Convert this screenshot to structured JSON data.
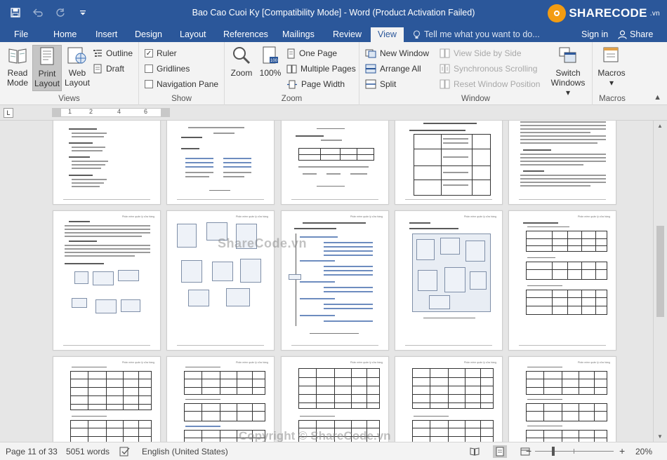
{
  "window": {
    "title": "Bao Cao Cuoi Ky  [Compatibility Mode] - Word (Product Activation Failed)",
    "logo_text": "SHARECODE",
    "logo_suffix": ".vn"
  },
  "quick_access": {
    "save": "save-icon",
    "undo": "undo-icon",
    "redo": "redo-icon",
    "customize": "customize-icon"
  },
  "tabs": [
    {
      "label": "File"
    },
    {
      "label": "Home"
    },
    {
      "label": "Insert"
    },
    {
      "label": "Design"
    },
    {
      "label": "Layout"
    },
    {
      "label": "References"
    },
    {
      "label": "Mailings"
    },
    {
      "label": "Review"
    },
    {
      "label": "View"
    }
  ],
  "active_tab": "View",
  "tell_me": "Tell me what you want to do...",
  "sign_in": "Sign in",
  "share": "Share",
  "ribbon": {
    "views": {
      "label": "Views",
      "read_mode": [
        "Read",
        "Mode"
      ],
      "print_layout": [
        "Print",
        "Layout"
      ],
      "web_layout": [
        "Web",
        "Layout"
      ],
      "outline": "Outline",
      "draft": "Draft"
    },
    "show": {
      "label": "Show",
      "ruler": "Ruler",
      "ruler_checked": true,
      "gridlines": "Gridlines",
      "gridlines_checked": false,
      "navigation_pane": "Navigation Pane",
      "navigation_checked": false
    },
    "zoom": {
      "label": "Zoom",
      "zoom": "Zoom",
      "hundred": "100%",
      "one_page": "One Page",
      "multiple_pages": "Multiple Pages",
      "page_width": "Page Width"
    },
    "window": {
      "label": "Window",
      "new_window": "New Window",
      "arrange_all": "Arrange All",
      "split": "Split",
      "view_side_by_side": "View Side by Side",
      "synchronous_scrolling": "Synchronous Scrolling",
      "reset_window_position": "Reset Window Position",
      "switch_windows": [
        "Switch",
        "Windows"
      ]
    },
    "macros": {
      "label": "Macros",
      "macros": "Macros"
    }
  },
  "ruler_numbers": [
    "1",
    "2",
    "4",
    "6"
  ],
  "doc": {
    "watermarks": [
      "ShareCode.vn",
      "Copyright © ShareCode.vn"
    ],
    "page_header": "Phân mềm quản lý cửa hàng",
    "chapter_title": "CHƯƠNG IV: THIẾT KẾ PHẦN MỀM"
  },
  "status": {
    "page": "Page 11 of 33",
    "words": "5051 words",
    "language": "English (United States)",
    "zoom_minus": "−",
    "zoom_plus": "+",
    "zoom_level": "20%",
    "zoom_fraction": 0.2
  }
}
